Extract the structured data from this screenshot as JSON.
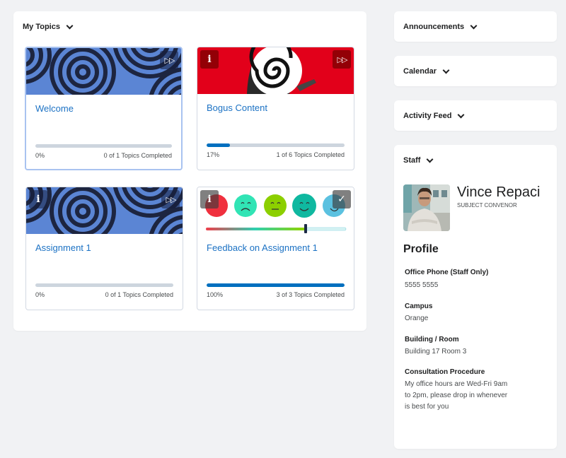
{
  "my_topics": {
    "title": "My Topics",
    "cards": [
      {
        "title": "Welcome",
        "percent_label": "0%",
        "progress": 0,
        "completed_label": "0 of 1 Topics Completed",
        "image": "blue-concentric-circles-pattern",
        "buttons": [
          "fast-forward"
        ]
      },
      {
        "title": "Bogus Content",
        "percent_label": "17%",
        "progress": 17,
        "completed_label": "1 of 6 Topics Completed",
        "image": "red-spiral-face",
        "buttons": [
          "info",
          "fast-forward"
        ]
      },
      {
        "title": "Assignment 1",
        "percent_label": "0%",
        "progress": 0,
        "completed_label": "0 of 1 Topics Completed",
        "image": "blue-concentric-circles-pattern",
        "buttons": [
          "info",
          "fast-forward"
        ]
      },
      {
        "title": "Feedback on Assignment 1",
        "percent_label": "100%",
        "progress": 100,
        "completed_label": "3 of 3 Topics Completed",
        "image": "emoji-feedback-scale",
        "buttons": [
          "info",
          "checkmark"
        ]
      }
    ]
  },
  "sidebar": {
    "announcements": "Announcements",
    "calendar": "Calendar",
    "activity_feed": "Activity Feed",
    "staff": {
      "title": "Staff",
      "name": "Vince Repaci",
      "role": "SUBJECT CONVENOR",
      "profile_heading": "Profile",
      "fields": [
        {
          "label": "Office Phone (Staff Only)",
          "value": "5555 5555"
        },
        {
          "label": "Campus",
          "value": "Orange"
        },
        {
          "label": "Building / Room",
          "value": "Building 17 Room 3"
        },
        {
          "label": "Consultation Procedure",
          "value": "My office hours are Wed-Fri 9am to 2pm, please drop in whenever is best for you"
        }
      ]
    }
  },
  "colors": {
    "link": "#1c72c4",
    "progress_fill": "#006fbf",
    "progress_track": "#cdd5de",
    "page_bg": "#f1f2f4"
  },
  "icons": {
    "info": "i",
    "fast_forward": "▷▷",
    "check": "✓"
  }
}
